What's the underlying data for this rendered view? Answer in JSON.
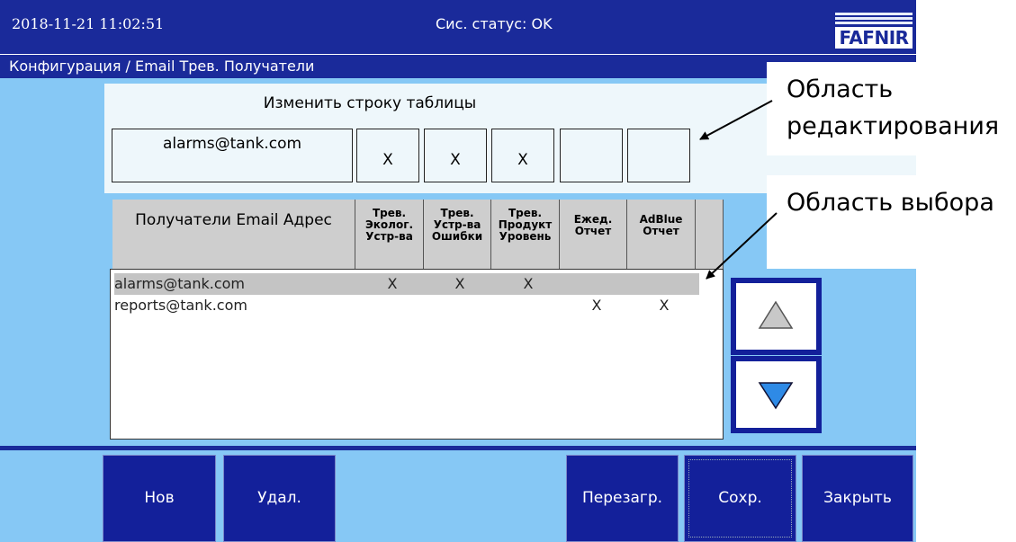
{
  "header": {
    "datetime": "2018-11-21  11:02:51",
    "status": "Сис. статус: OK",
    "logo_text": "FAFNIR"
  },
  "breadcrumb": "Конфигурация / Email Трев. Получатели",
  "edit_area": {
    "title": "Изменить строку таблицы",
    "email": "alarms@tank.com",
    "flags": [
      "X",
      "X",
      "X",
      "",
      ""
    ]
  },
  "table": {
    "headers": {
      "email": "Получатели Email Адрес",
      "env_device": "Трев. Эколог. Устр-ва",
      "device_error": "Трев. Устр-ва Ошибки",
      "product_level": "Трев. Продукт Уровень",
      "daily_report": "Ежед. Отчет",
      "adblue_report": "AdBlue Отчет"
    },
    "rows": [
      {
        "email": "alarms@tank.com",
        "marks": [
          "X",
          "X",
          "X",
          "",
          ""
        ],
        "selected": true
      },
      {
        "email": "reports@tank.com",
        "marks": [
          "",
          "",
          "",
          "X",
          "X"
        ],
        "selected": false
      }
    ]
  },
  "scroll": {
    "up_icon": "triangle-up-icon",
    "down_icon": "triangle-down-icon",
    "up_color": "#c8c8c8",
    "down_color": "#2e8ae6"
  },
  "buttons": {
    "new": "Нов",
    "delete": "Удал.",
    "reload": "Перезагр.",
    "save": "Сохр.",
    "close": "Закрыть"
  },
  "callouts": {
    "edit_area": "Область редактирования",
    "selection_area": "Область выбора"
  },
  "colors": {
    "background": "#86c8f5",
    "bar": "#1a2a9a",
    "selected_row": "#c4c4c4"
  }
}
